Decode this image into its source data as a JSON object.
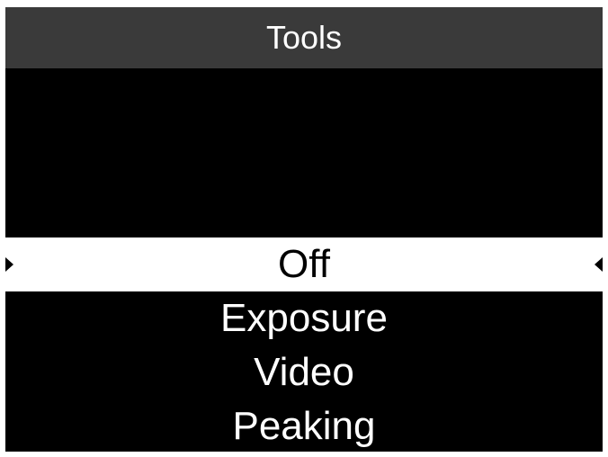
{
  "header": {
    "title": "Tools"
  },
  "menu": {
    "items": [
      {
        "label": "Off",
        "selected": true
      },
      {
        "label": "Exposure",
        "selected": false
      },
      {
        "label": "Video",
        "selected": false
      },
      {
        "label": "Peaking",
        "selected": false
      }
    ]
  },
  "colors": {
    "background": "#000000",
    "title_bar": "#3a3a3a",
    "highlight": "#ffffff",
    "text": "#ffffff",
    "selected_text": "#000000"
  },
  "icons": {
    "left_indicator": "triangle-right-icon",
    "right_indicator": "triangle-left-icon"
  }
}
